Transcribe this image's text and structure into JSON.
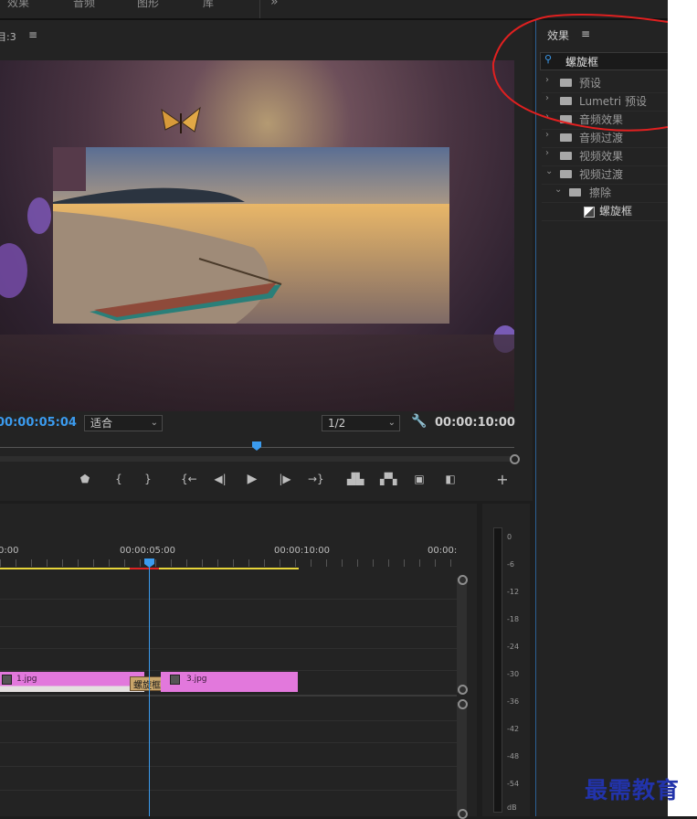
{
  "menu": {
    "items": [
      "效果",
      "音频",
      "图形",
      "库"
    ],
    "more": "»"
  },
  "program_monitor": {
    "title": "目:3",
    "menu_icon": "≡",
    "timecode_current": "00:00:05:04",
    "fit_select": "适合",
    "resolution_select": "1/2",
    "timecode_duration": "00:00:10:00",
    "controls": [
      "marker-icon",
      "in-point-icon",
      "out-point-icon",
      "go-to-in-icon",
      "step-back-icon",
      "play-icon",
      "step-forward-icon",
      "go-to-out-icon",
      "lift-icon",
      "extract-icon",
      "camera-icon",
      "compare-icon",
      "add-icon"
    ]
  },
  "timeline": {
    "ruler_labels": [
      "0:00",
      "00:00:05:00",
      "00:00:10:00",
      "00:00:"
    ],
    "clips": [
      {
        "label": "1.jpg"
      },
      {
        "label": "螺旋框"
      },
      {
        "label": "3.jpg"
      }
    ]
  },
  "meter": {
    "ticks": [
      "0",
      "-6",
      "-12",
      "-18",
      "-24",
      "-30",
      "-36",
      "-42",
      "-48",
      "-54",
      "dB"
    ]
  },
  "effects_panel": {
    "title": "效果",
    "menu_icon": "≡",
    "search_value": "螺旋框",
    "items": [
      {
        "label": "预设",
        "expanded": false
      },
      {
        "label": "Lumetri 预设",
        "expanded": false
      },
      {
        "label": "音频效果",
        "expanded": false
      },
      {
        "label": "音频过渡",
        "expanded": false
      },
      {
        "label": "视频效果",
        "expanded": false
      },
      {
        "label": "视频过渡",
        "expanded": true
      }
    ],
    "subfolder": "擦除",
    "effect": "螺旋框"
  },
  "watermark": "最需教育",
  "colors": {
    "accent_blue": "#3b9bee",
    "clip_pink": "#e278dc",
    "annotation_red": "#e02020",
    "playhead_yellow": "#e6d43a"
  }
}
